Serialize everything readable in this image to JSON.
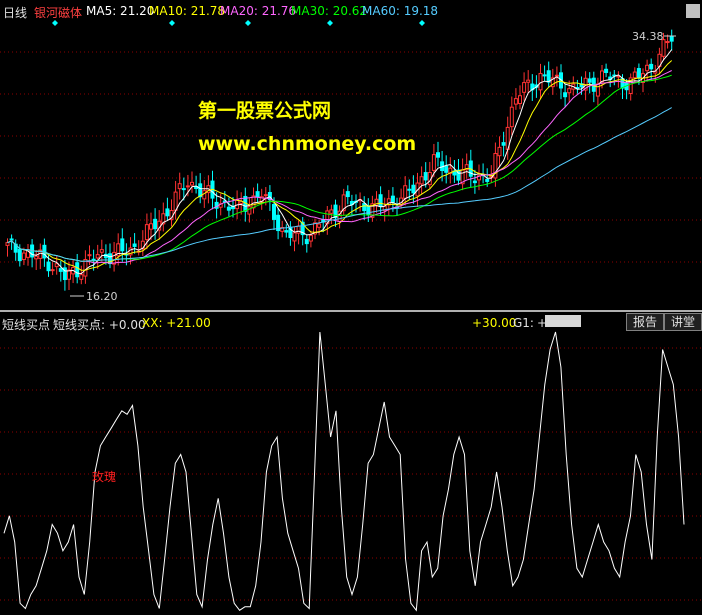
{
  "price_panel": {
    "period_label": "日线",
    "indicator_name": "银河磁体",
    "ma_labels": [
      {
        "text": "MA5: 21.20",
        "color": "#ffffff"
      },
      {
        "text": "MA10: 21.78",
        "color": "#ffff00"
      },
      {
        "text": "MA20: 21.76",
        "color": "#ff66ff"
      },
      {
        "text": "MA30: 20.62",
        "color": "#00ff00"
      },
      {
        "text": "MA60: 19.18",
        "color": "#55ccff"
      }
    ],
    "high_label": "34.38",
    "low_label": "16.20",
    "watermark_title": "第一股票公式网",
    "watermark_url": "www.chnmoney.com",
    "up_color": "#ff3333",
    "down_color": "#00ffff"
  },
  "indicator_panel": {
    "name": "短线买点",
    "value_label": "短线买点: +0.00",
    "xx_label": "XX: +21.00",
    "right_value": "+30.00",
    "g1_label": "G1:",
    "g1_value": "+",
    "annotation": "玫瑰",
    "tab_report": "报告",
    "tab_comment": "讲堂",
    "line_values": [
      45,
      55,
      40,
      5,
      2,
      10,
      15,
      25,
      35,
      50,
      45,
      35,
      40,
      50,
      20,
      10,
      40,
      80,
      95,
      100,
      105,
      110,
      115,
      113,
      118,
      95,
      60,
      35,
      10,
      2,
      30,
      60,
      85,
      90,
      80,
      45,
      10,
      3,
      30,
      50,
      65,
      45,
      20,
      5,
      1,
      3,
      3,
      15,
      40,
      80,
      95,
      100,
      65,
      45,
      35,
      25,
      5,
      2,
      80,
      160,
      130,
      100,
      115,
      60,
      20,
      10,
      20,
      50,
      85,
      90,
      105,
      120,
      100,
      95,
      90,
      30,
      5,
      1,
      35,
      40,
      20,
      25,
      55,
      70,
      90,
      100,
      90,
      35,
      15,
      40,
      50,
      60,
      80,
      60,
      35,
      15,
      20,
      30,
      50,
      70,
      100,
      130,
      150,
      160,
      140,
      90,
      50,
      25,
      20,
      30,
      40,
      50,
      40,
      35,
      25,
      20,
      40,
      55,
      90,
      80,
      50,
      30,
      100,
      150,
      140,
      130,
      100,
      50
    ]
  },
  "colors": {
    "background": "#000000",
    "grid": "#8b0000",
    "axis": "#b0b0b0"
  }
}
